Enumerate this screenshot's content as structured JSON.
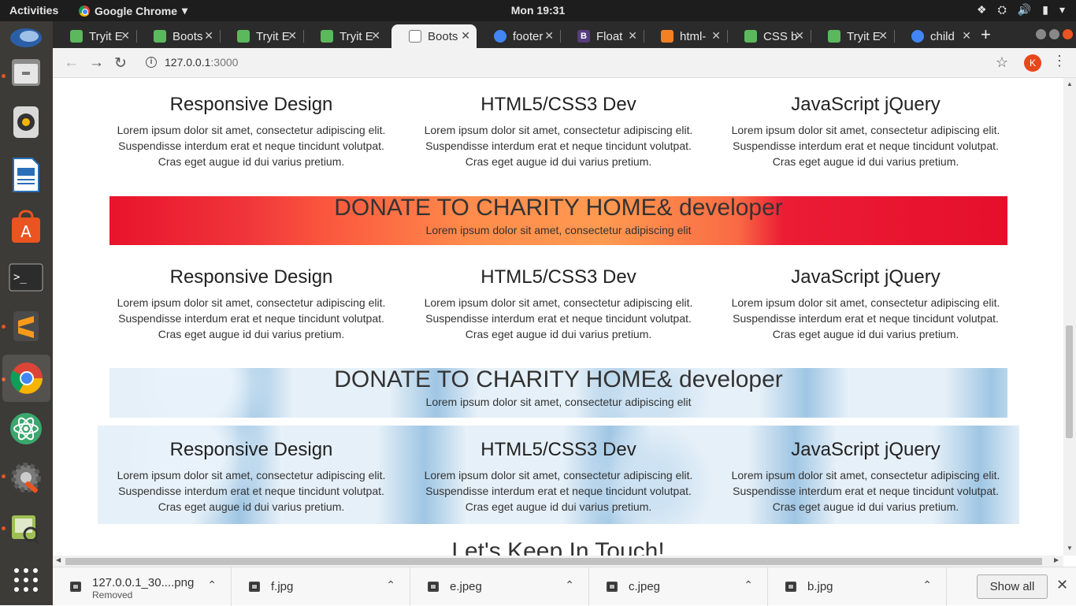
{
  "system": {
    "activities": "Activities",
    "app_name": "Google Chrome",
    "clock": "Mon 19:31"
  },
  "tabs": [
    {
      "title": "Tryit E",
      "favicon_color": "#5cb85c"
    },
    {
      "title": "Boots",
      "favicon_color": "#5cb85c"
    },
    {
      "title": "Tryit E",
      "favicon_color": "#5cb85c"
    },
    {
      "title": "Tryit E",
      "favicon_color": "#5cb85c"
    },
    {
      "title": "Boots",
      "favicon_color": "#ffffff",
      "active": true
    },
    {
      "title": "footer",
      "favicon_color": "#4285f4"
    },
    {
      "title": "Float",
      "favicon_color": "#563d7c"
    },
    {
      "title": "html-",
      "favicon_color": "#f48024"
    },
    {
      "title": "CSS b",
      "favicon_color": "#5cb85c"
    },
    {
      "title": "Tryit E",
      "favicon_color": "#5cb85c"
    },
    {
      "title": "child",
      "favicon_color": "#4285f4"
    }
  ],
  "toolbar": {
    "url_host": "127.0.0.1",
    "url_port": ":3000",
    "avatar_letter": "K"
  },
  "page": {
    "sections": [
      {
        "title": "Responsive Design",
        "lines": [
          "Lorem ipsum dolor sit amet, consectetur adipiscing elit.",
          "Suspendisse interdum erat et neque tincidunt volutpat.",
          "Cras eget augue id dui varius pretium."
        ]
      },
      {
        "title": "HTML5/CSS3 Dev",
        "lines": [
          "Lorem ipsum dolor sit amet, consectetur adipiscing elit.",
          "Suspendisse interdum erat et neque tincidunt volutpat.",
          "Cras eget augue id dui varius pretium."
        ]
      },
      {
        "title": "JavaScript jQuery",
        "lines": [
          "Lorem ipsum dolor sit amet, consectetur adipiscing elit.",
          "Suspendisse interdum erat et neque tincidunt volutpat.",
          "Cras eget augue id dui varius pretium."
        ]
      }
    ],
    "banner_title": "DONATE TO CHARITY HOME& developer",
    "banner_text": "Lorem ipsum dolor sit amet, consectetur adipiscing elit",
    "bottom_heading": "Let's Keep In Touch!"
  },
  "downloads": [
    {
      "name": "127.0.0.1_30....png",
      "status": "Removed"
    },
    {
      "name": "f.jpg",
      "status": ""
    },
    {
      "name": "e.jpeg",
      "status": ""
    },
    {
      "name": "c.jpeg",
      "status": ""
    },
    {
      "name": "b.jpg",
      "status": ""
    }
  ],
  "shelf": {
    "show_all": "Show all"
  }
}
